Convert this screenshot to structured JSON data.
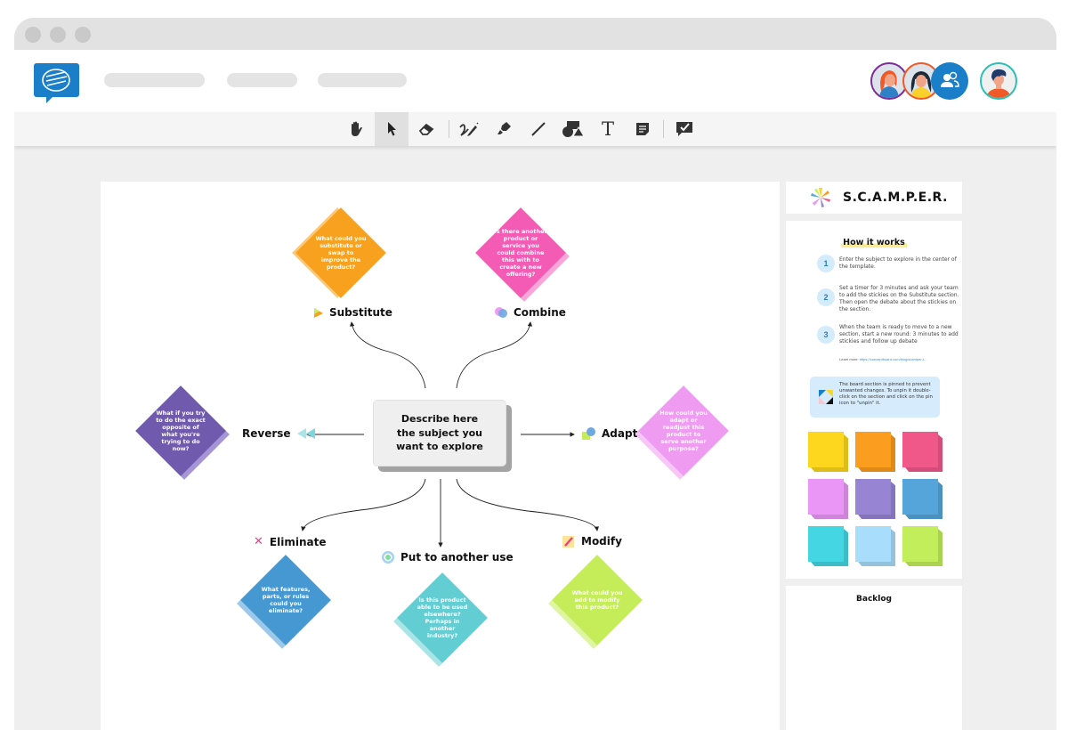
{
  "window": {
    "nav_placeholders": 3
  },
  "header": {
    "logo": "conceptboard-logo-icon",
    "avatars": [
      {
        "name": "avatar-user-red-hair",
        "ring": "#7b2d9a"
      },
      {
        "name": "avatar-user-dark-hair",
        "ring": "#f05a28"
      },
      {
        "name": "avatar-group-users",
        "ring": "#1a7ec8"
      },
      {
        "name": "avatar-user-man",
        "ring": "#2bbfb5"
      }
    ]
  },
  "toolbar": {
    "tools": [
      {
        "name": "hand-tool",
        "icon": "hand-icon"
      },
      {
        "name": "select-tool",
        "icon": "cursor-icon",
        "active": true
      },
      {
        "name": "eraser-tool",
        "icon": "eraser-icon"
      },
      {
        "name": "pen-tool",
        "icon": "pen-icon"
      },
      {
        "name": "highlighter-tool",
        "icon": "highlighter-icon"
      },
      {
        "name": "line-tool",
        "icon": "line-icon"
      },
      {
        "name": "shapes-tool",
        "icon": "shapes-icon"
      },
      {
        "name": "text-tool",
        "icon": "text-icon",
        "glyph": "T"
      },
      {
        "name": "sticky-note-tool",
        "icon": "sticky-note-icon"
      },
      {
        "name": "review-tool",
        "icon": "comment-check-icon"
      }
    ]
  },
  "board": {
    "center_text": "Describe here the subject you want to explore",
    "branches": [
      {
        "key": "substitute",
        "label": "Substitute",
        "question": "What could you substitute or swap to improve the product?",
        "color": "#f7a11e",
        "shadow": "#fbc878"
      },
      {
        "key": "combine",
        "label": "Combine",
        "question": "Is there another product or service you could combine this with to create a new offering?",
        "color": "#f35bb5",
        "shadow": "#f8a6d8"
      },
      {
        "key": "reverse",
        "label": "Reverse",
        "question": "What if you try to do the exact opposite of what you're trying to do now?",
        "color": "#6f5aae",
        "shadow": "#a595d4"
      },
      {
        "key": "adapt",
        "label": "Adapt",
        "question": "How could you adapt or readjust this product to serve another purpose?",
        "color": "#f09bf2",
        "shadow": "#f6c6f7"
      },
      {
        "key": "eliminate",
        "label": "Eliminate",
        "question": "What features, parts, or rules could you eliminate?",
        "color": "#4698d3",
        "shadow": "#9cc9ea"
      },
      {
        "key": "put_to_another_use",
        "label": "Put to another use",
        "question": "Is this product able to be used elsewhere? Perhaps in another industry?",
        "color": "#62cdd3",
        "shadow": "#a9e4e7"
      },
      {
        "key": "modify",
        "label": "Modify",
        "question": "What could you add to modify this product?",
        "color": "#c5ed5a",
        "shadow": "#def6a2"
      }
    ]
  },
  "sidebar": {
    "title": "S.C.A.M.P.E.R.",
    "how_it_works": "How it works",
    "steps": [
      {
        "number": "1",
        "text": "Enter the subject to explore in the center of the template."
      },
      {
        "number": "2",
        "text": "Set a timer for 3 minutes and ask your team to add the stickies on the Substitute section. Then open the debate about the stickies on the section."
      },
      {
        "number": "3",
        "text": "When the team is ready to move to a new section, start a new round: 3 minutes to add stickies and follow up debate"
      }
    ],
    "learn_more_label": "Learn more:",
    "learn_more_link": "https://conceptboard.com/blog/scamper-t...",
    "pinned_notice": "The board section is pinned to prevent unwanted changes. To unpin it double-click on the section and click on the pin icon to \"unpin\" it.",
    "sticky_colors": [
      "#fcd71e",
      "#fb9d1f",
      "#ef5889",
      "#ea96f6",
      "#9784d3",
      "#55a5da",
      "#45d6e3",
      "#a8ddfb",
      "#c2ee5b"
    ],
    "backlog_title": "Backlog"
  }
}
